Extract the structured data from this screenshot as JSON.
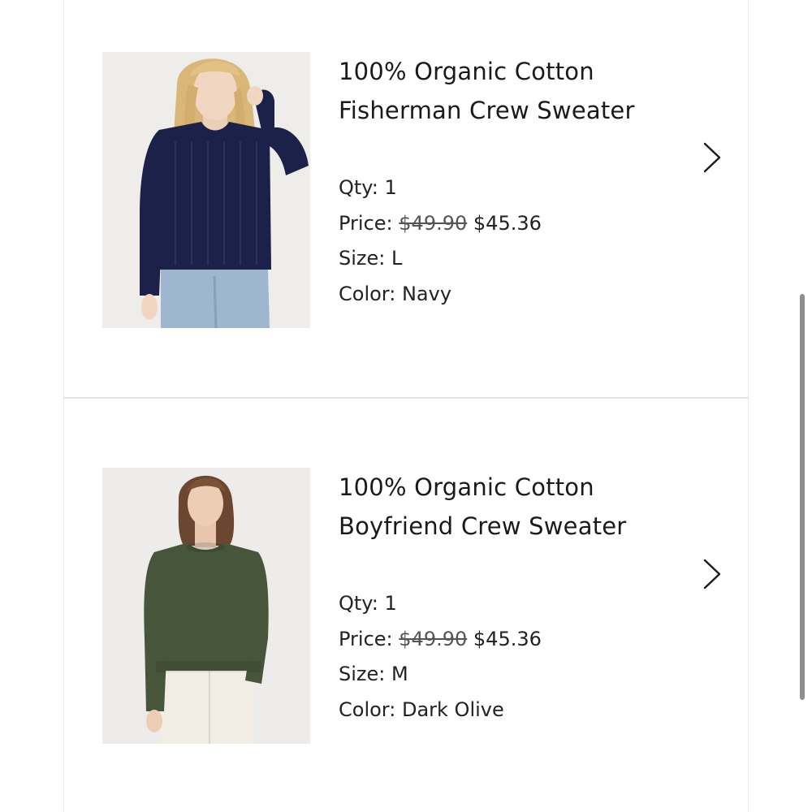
{
  "items": [
    {
      "title_line1": "100% Organic Cotton",
      "title_line2": "Fisherman Crew Sweater",
      "qty_label": "Qty:",
      "qty_value": "1",
      "price_label": "Price:",
      "price_original": "$49.90",
      "price_sale": "$45.36",
      "size_label": "Size:",
      "size_value": "L",
      "color_label": "Color:",
      "color_value": "Navy",
      "image_icon": "product-photo-navy-sweater",
      "sweater_color": "#1b2148"
    },
    {
      "title_line1": "100% Organic Cotton",
      "title_line2": "Boyfriend Crew Sweater",
      "qty_label": "Qty:",
      "qty_value": "1",
      "price_label": "Price:",
      "price_original": "$49.90",
      "price_sale": "$45.36",
      "size_label": "Size:",
      "size_value": "M",
      "color_label": "Color:",
      "color_value": "Dark Olive",
      "image_icon": "product-photo-olive-sweater",
      "sweater_color": "#47553a"
    }
  ],
  "chevron_icon": "chevron-right-icon",
  "colors": {
    "divider": "#e4e4e4",
    "scrollbar": "#8e8e8e",
    "text": "#1a1a1a"
  }
}
